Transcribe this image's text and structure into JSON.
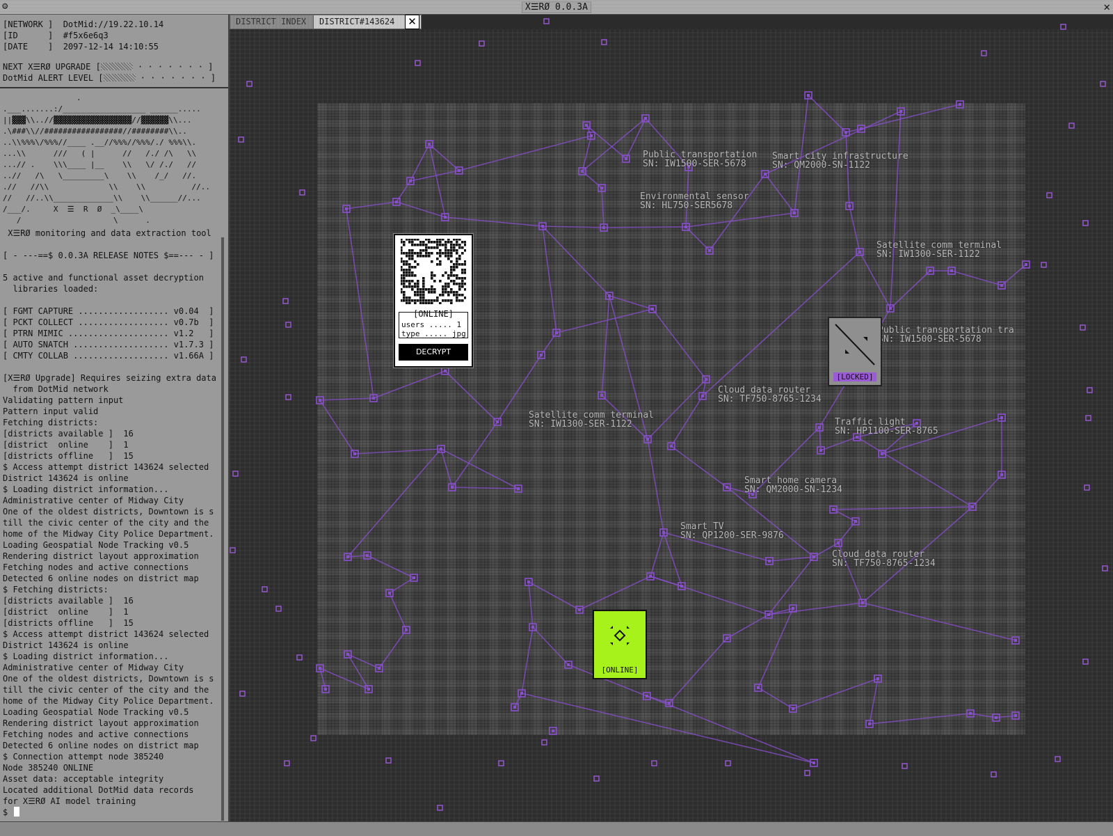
{
  "window": {
    "title": "X☰RØ 0.0.3A"
  },
  "header": {
    "network": "[NETWORK ]  DotMid://19.22.10.14",
    "id": "[ID      ]  #f5x6e6q3",
    "date": "[DATE    ]  2097-12-14 14:10:55",
    "upgrade_label": "NEXT X☰RØ UPGRADE [",
    "upgrade_dots": " · · · · · · · ]",
    "upgrade_progress": 0.2,
    "alert_label": "DotMid ALERT LEVEL [",
    "alert_dots": " · · · · · · · ]",
    "alert_progress": 0.2
  },
  "ascii_logo": "                .\n.___.......:/__________________ ______.....\n||▓▓▓\\\\..//▓▓▓▓▓▓▓▓▓▓▓▓▓▓▓▓▓//▓▓▓▓▓▓\\\\...\n.\\###\\\\//#################//########\\\\..\n..\\\\%%%\\/%%%//____ .__//%%%//%%%/./ %%%\\\\.\n...\\\\      ///   ( |      //   /./ /\\   \\\\\n...// .    \\\\\\____ |__    \\\\   \\/ /./   //\n..//   /\\   \\_________\\    \\\\    /_/   //.\n.//   //\\\\             \\\\    \\\\          //..\n//   //..\\\\_____________\\\\    \\\\______//...\n/___/.     X  ☰  R  Ø  _\\____\\\n   /                    \\      .",
  "tool_caption": " X☰RØ monitoring and data extraction tool",
  "log_lines": [
    "[ - ---==$ 0.0.3A RELEASE NOTES $==--- - ]",
    "",
    "5 active and functional asset decryption",
    "  libraries loaded:",
    "",
    "[ FGMT CAPTURE .................. v0.04  ]",
    "[ PCKT COLLECT .................. v0.7b  ]",
    "[ PTRN MIMIC .................... v1.2   ]",
    "[ AUTO SNATCH ................... v1.7.3 ]",
    "[ CMTY COLLAB ................... v1.66A ]",
    "",
    "[X☰RØ Upgrade] Requires seizing extra data",
    "  from DotMid network",
    "Validating pattern input",
    "Pattern input valid",
    "Fetching districts:",
    "[districts available ]  16",
    "[district  online    ]  1",
    "[districts offline   ]  15",
    "$ Access attempt district 143624 selected",
    "District 143624 is online",
    "$ Loading district information...",
    "Administrative center of Midway City",
    "One of the oldest districts, Downtown is s",
    "till the civic center of the city and the",
    "home of the Midway City Police Department.",
    "Loading Geospatial Node Tracking v0.5",
    "Rendering district layout approximation",
    "Fetching nodes and active connections",
    "Detected 6 online nodes on district map",
    "$ Fetching districts:",
    "[districts available ]  16",
    "[district  online    ]  1",
    "[districts offline   ]  15",
    "$ Access attempt district 143624 selected",
    "District 143624 is online",
    "$ Loading district information...",
    "Administrative center of Midway City",
    "One of the oldest districts, Downtown is s",
    "till the civic center of the city and the",
    "home of the Midway City Police Department.",
    "Loading Geospatial Node Tracking v0.5",
    "Rendering district layout approximation",
    "Fetching nodes and active connections",
    "Detected 6 online nodes on district map",
    "$ Connection attempt node 385240",
    "Node 385240 ONLINE",
    "Asset data: acceptable integrity",
    "Located additional DotMid data records",
    "for X☰RØ AI model training"
  ],
  "prompt": "$ ",
  "tabs": [
    {
      "label": "DISTRICT INDEX"
    },
    {
      "label": "DISTRICT#143624"
    }
  ],
  "tab_close_glyph": "✕",
  "map_labels": [
    {
      "name": "Public transportation",
      "sn": "SN: IW1500-SER-5678"
    },
    {
      "name": "Smart city infrastructure",
      "sn": "SN: QM2000-SN-1122"
    },
    {
      "name": "Environmental sensor",
      "sn": "SN: HL750-SER5678"
    },
    {
      "name": "Satellite comm terminal",
      "sn": "SN: IW1300-SER-1122"
    },
    {
      "name": "Public transportation tra",
      "sn": "SN: IW1500-SER-5678"
    },
    {
      "name": "Cloud data router",
      "sn": "SN: TF750-8765-1234"
    },
    {
      "name": "Satellite comm terminal",
      "sn": "SN: IW1300-SER-1122"
    },
    {
      "name": "Traffic light",
      "sn": "SN: HP1100-SER-8765"
    },
    {
      "name": "Smart home camera",
      "sn": "SN: QM2000-SN-1234"
    },
    {
      "name": "Smart TV",
      "sn": "SN: QP1200-SER-9876"
    },
    {
      "name": "Cloud data router",
      "sn": "SN: TF750-8765-1234"
    }
  ],
  "node_card": {
    "status": "[ONLINE]",
    "users_row": "users ..... 1",
    "type_row": "type ..... jpg",
    "button": "DECRYPT"
  },
  "locked_card": {
    "status": "[LOCKED]"
  },
  "target_card": {
    "status": "[ONLINE]"
  },
  "colors": {
    "accent": "#9b5ad6",
    "link": "#8a4fd0",
    "online_green": "#a6f21a",
    "panel": "#9a9a9a"
  }
}
